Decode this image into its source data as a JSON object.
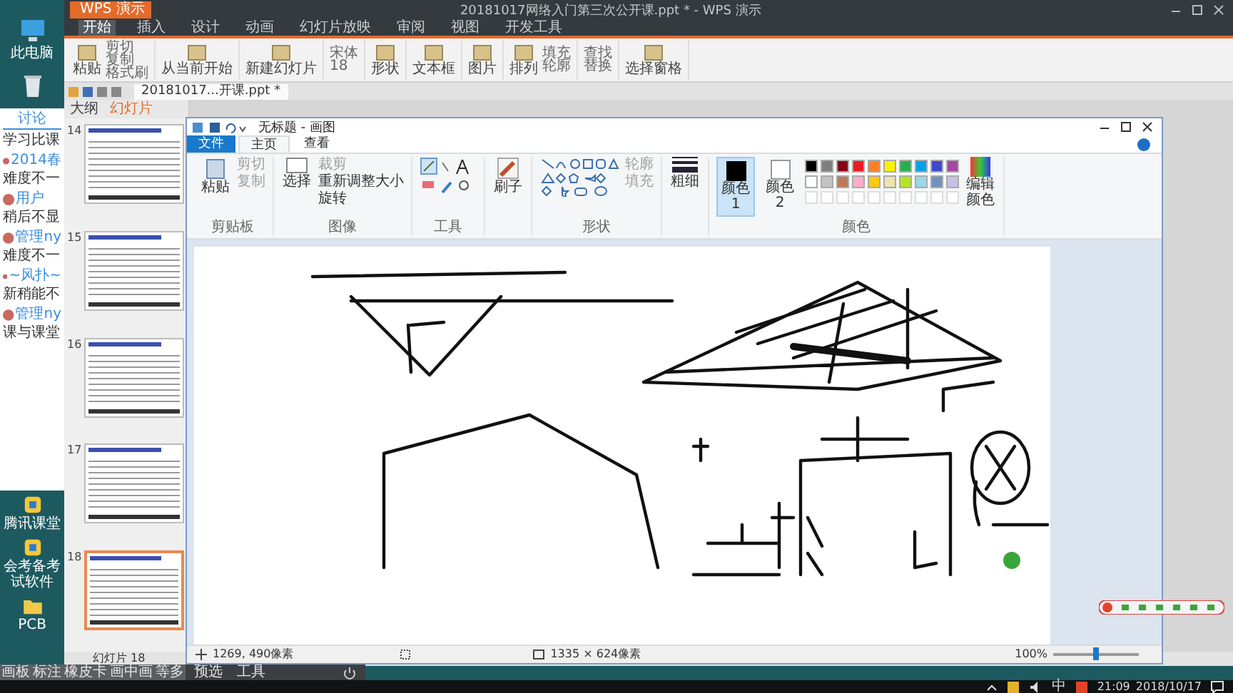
{
  "desktop": {
    "icons": [
      {
        "label": "此电脑",
        "kind": "pc"
      },
      {
        "label": "腾讯课堂",
        "kind": "app"
      },
      {
        "label": "会考备考试软件",
        "kind": "app"
      },
      {
        "label": "PCB",
        "kind": "folder"
      }
    ]
  },
  "chat": {
    "tab": "讨论",
    "messages": [
      {
        "text": "学习比课"
      },
      {
        "user": "2014春",
        "text": "难度不一"
      },
      {
        "user": "用户",
        "text": "稍后不显"
      },
      {
        "user": "管理ny",
        "text": "难度不一"
      },
      {
        "user": "~风扑~",
        "text": "新稍能不"
      },
      {
        "user": "管理ny",
        "text": "课与课堂"
      }
    ]
  },
  "wps": {
    "app_button": "WPS 演示",
    "title": "20181017网络入门第三次公开课.ppt * - WPS 演示",
    "menu": [
      {
        "label": "开始",
        "selected": true
      },
      {
        "label": "插入",
        "selected": false
      },
      {
        "label": "设计",
        "selected": false
      },
      {
        "label": "动画",
        "selected": false
      },
      {
        "label": "幻灯片放映",
        "selected": false
      },
      {
        "label": "审阅",
        "selected": false
      },
      {
        "label": "视图",
        "selected": false
      },
      {
        "label": "开发工具",
        "selected": false
      }
    ],
    "ribbon": [
      {
        "large": "粘贴",
        "small": [
          "剪切",
          "复制",
          "格式刷"
        ]
      },
      {
        "large": "从当前开始"
      },
      {
        "large": "新建幻灯片"
      },
      {
        "small": [
          "宋体",
          "18"
        ]
      },
      {
        "large": "形状"
      },
      {
        "large": "文本框"
      },
      {
        "large": "图片"
      },
      {
        "large": "排列",
        "small": [
          "填充",
          "轮廓"
        ]
      },
      {
        "small": [
          "查找",
          "替换"
        ]
      },
      {
        "large": "选择窗格"
      }
    ],
    "doc_tab": "20181017...开课.ppt *",
    "panel_tabs": [
      {
        "label": "大纲",
        "selected": false
      },
      {
        "label": "幻灯片",
        "selected": true
      }
    ],
    "slides": [
      {
        "number": "14",
        "selected": false
      },
      {
        "number": "15",
        "selected": false
      },
      {
        "number": "16",
        "selected": false
      },
      {
        "number": "17",
        "selected": false
      },
      {
        "number": "18",
        "selected": true
      }
    ],
    "status": "幻灯片 18"
  },
  "paint": {
    "title": "无标题 - 画图",
    "tabs": [
      {
        "label": "文件",
        "kind": "file",
        "selected": false
      },
      {
        "label": "主页",
        "kind": "tab",
        "selected": true
      },
      {
        "label": "查看",
        "kind": "tab",
        "selected": false
      }
    ],
    "clipboard": {
      "paste": "粘贴",
      "cut": "剪切",
      "copy": "复制",
      "label": "剪贴板"
    },
    "image": {
      "select": "选择",
      "crop": "裁剪",
      "resize": "重新调整大小",
      "rotate": "旋转",
      "label": "图像"
    },
    "tools_label": "工具",
    "brush": "刷子",
    "shapes": {
      "outline": "轮廓",
      "fill": "填充",
      "label": "形状"
    },
    "size": "粗细",
    "color1": {
      "label": "颜色 1",
      "selected": true
    },
    "color2": {
      "label": "颜色 2",
      "selected": false
    },
    "palette": [
      {
        "color": "#000000"
      },
      {
        "color": "#7f7f7f"
      },
      {
        "color": "#880015"
      },
      {
        "color": "#ed1c24"
      },
      {
        "color": "#ff7f27"
      },
      {
        "color": "#fff200"
      },
      {
        "color": "#22b14c"
      },
      {
        "color": "#00a2e8"
      },
      {
        "color": "#3f48cc"
      },
      {
        "color": "#a349a4"
      },
      {
        "color": "#ffffff"
      },
      {
        "color": "#c3c3c3"
      },
      {
        "color": "#b97a57"
      },
      {
        "color": "#ffaec9"
      },
      {
        "color": "#ffc90e"
      },
      {
        "color": "#efe4b0"
      },
      {
        "color": "#b5e61d"
      },
      {
        "color": "#99d9ea"
      },
      {
        "color": "#7092be"
      },
      {
        "color": "#c8bfe7"
      }
    ],
    "colors_label": "颜色",
    "edit_colors": "编辑颜色",
    "status": {
      "cursor": "1269, 490像素",
      "canvas_size": "1335 × 624像素",
      "zoom": "100%"
    },
    "zoom_slider": {
      "level": 0.5
    }
  },
  "toolbar_overlay": {
    "items": [
      "画板",
      "标注",
      "橡皮卡",
      "画中画",
      "等多"
    ],
    "popup": [
      "预选",
      "工具"
    ]
  },
  "taskbar": {
    "ime": "中",
    "time": "21:09",
    "date": "2018/10/17"
  }
}
